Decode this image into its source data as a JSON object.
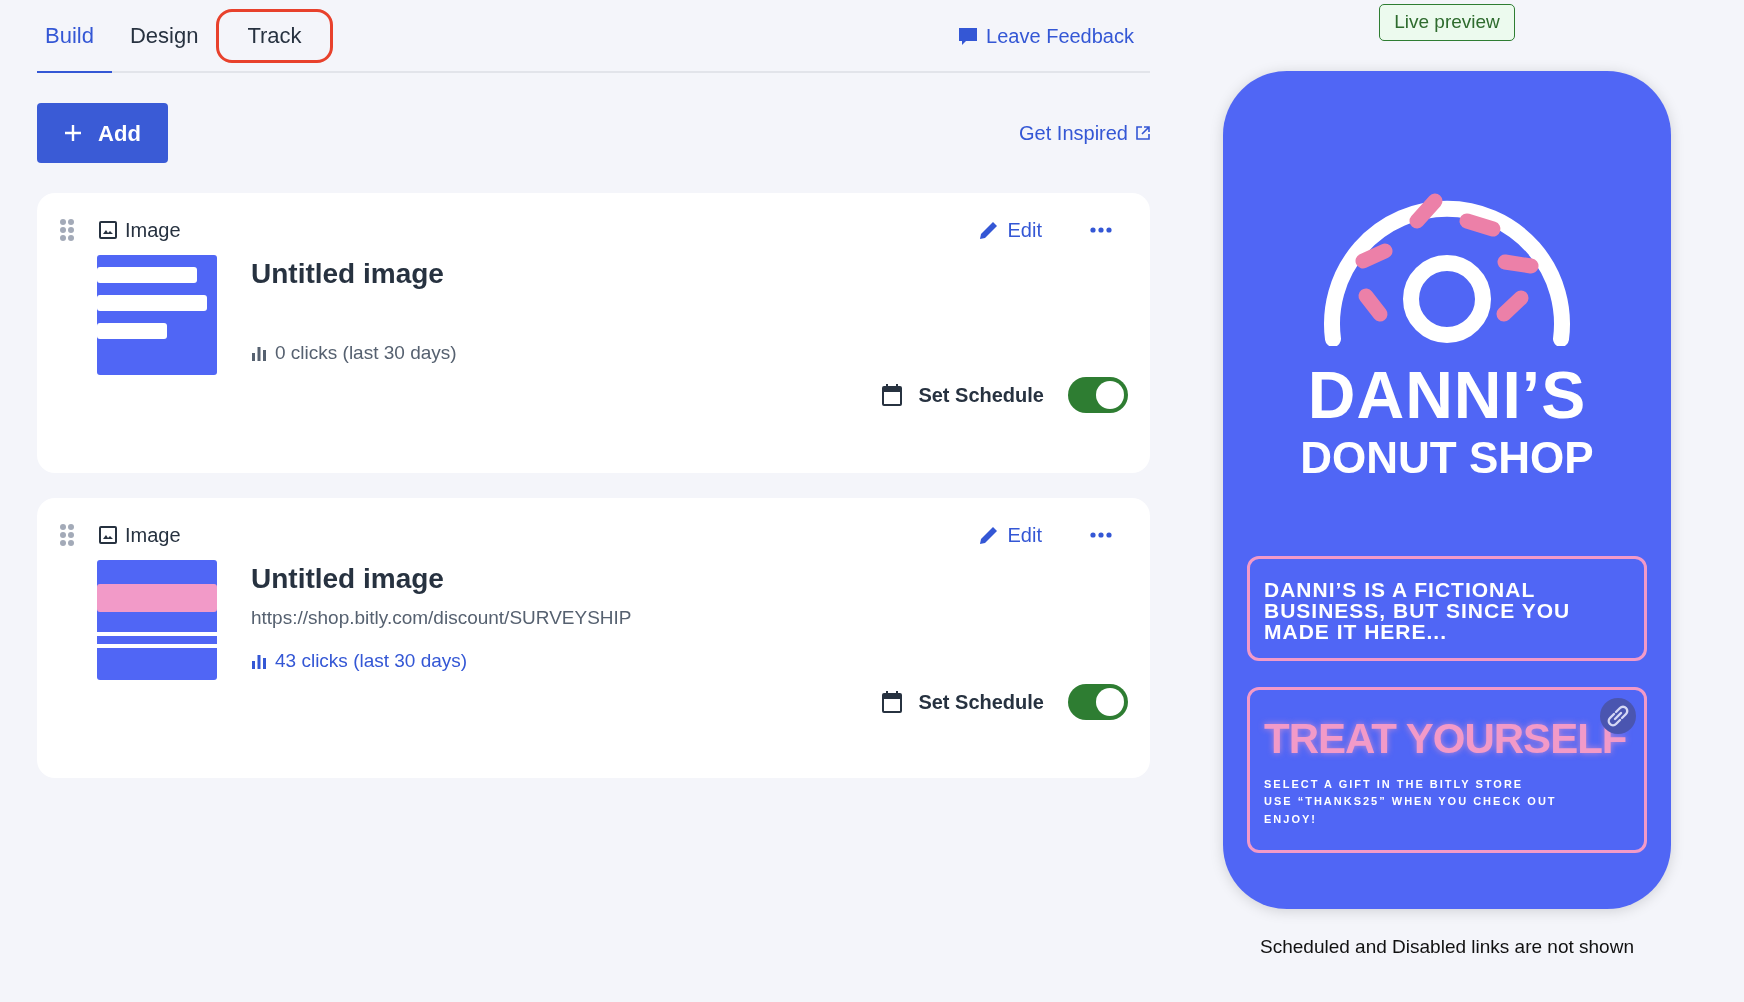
{
  "tabs": [
    {
      "label": "Build",
      "selected": true,
      "circled": false
    },
    {
      "label": "Design",
      "selected": false,
      "circled": false
    },
    {
      "label": "Track",
      "selected": false,
      "circled": true
    }
  ],
  "feedback_link": "Leave Feedback",
  "add_button": "Add",
  "inspired_link": "Get Inspired",
  "links": [
    {
      "type_label": "Image",
      "edit": "Edit",
      "title": "Untitled image",
      "clicks": "0 clicks (last 30 days)",
      "has_clicks": false,
      "schedule": "Set Schedule",
      "on": true
    },
    {
      "type_label": "Image",
      "edit": "Edit",
      "title": "Untitled image",
      "url": "https://shop.bitly.com/discount/SURVEYSHIP",
      "clicks": "43 clicks (last 30 days)",
      "has_clicks": true,
      "schedule": "Set Schedule",
      "on": true
    }
  ],
  "preview": {
    "badge": "Live preview",
    "logo_line1": "DANNI’S",
    "logo_line2": "DONUT SHOP",
    "tiles": [
      {
        "kind": "text",
        "text": "DANNI’S IS A FICTIONAL BUSINESS, BUT SINCE YOU MADE IT HERE..."
      },
      {
        "kind": "promo",
        "headline": "TREAT YOURSELF",
        "lines": [
          "SELECT A GIFT IN THE BITLY STORE",
          "USE “THANKS25” WHEN YOU CHECK OUT",
          "ENJOY!"
        ]
      }
    ],
    "note": "Scheduled and Disabled links are not shown"
  }
}
